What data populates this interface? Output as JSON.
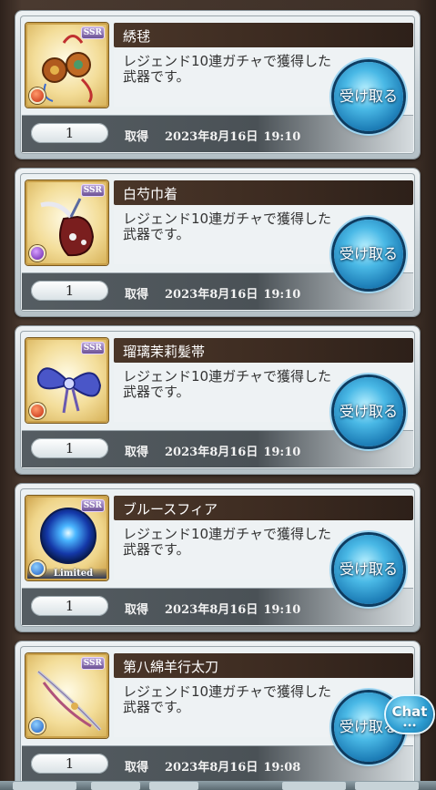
{
  "items": [
    {
      "name": "綉毬",
      "description": "レジェンド10連ガチャで獲得した武器です。",
      "rarity": "SSR",
      "element": "fire",
      "quantity": "1",
      "acquired_label": "取得",
      "acquired_date": "2023年8月16日",
      "acquired_time": "19:10",
      "claim_label": "受け取る",
      "limited_label": ""
    },
    {
      "name": "白芍巾着",
      "description": "レジェンド10連ガチャで獲得した武器です。",
      "rarity": "SSR",
      "element": "dark",
      "quantity": "1",
      "acquired_label": "取得",
      "acquired_date": "2023年8月16日",
      "acquired_time": "19:10",
      "claim_label": "受け取る",
      "limited_label": ""
    },
    {
      "name": "瑠璃茉莉髪帯",
      "description": "レジェンド10連ガチャで獲得した武器です。",
      "rarity": "SSR",
      "element": "fire",
      "quantity": "1",
      "acquired_label": "取得",
      "acquired_date": "2023年8月16日",
      "acquired_time": "19:10",
      "claim_label": "受け取る",
      "limited_label": ""
    },
    {
      "name": "ブルースフィア",
      "description": "レジェンド10連ガチャで獲得した武器です。",
      "rarity": "SSR",
      "element": "water",
      "quantity": "1",
      "acquired_label": "取得",
      "acquired_date": "2023年8月16日",
      "acquired_time": "19:10",
      "claim_label": "受け取る",
      "limited_label": "Limited"
    },
    {
      "name": "第八綿羊行太刀",
      "description": "レジェンド10連ガチャで獲得した武器です。",
      "rarity": "SSR",
      "element": "water",
      "quantity": "1",
      "acquired_label": "取得",
      "acquired_date": "2023年8月16日",
      "acquired_time": "19:08",
      "claim_label": "受け取る",
      "limited_label": ""
    }
  ],
  "chat": {
    "label": "Chat",
    "dots": "•••"
  },
  "colors": {
    "claim_button": "#2b9bd0",
    "title_bar": "#3b2a20",
    "background": "#3a2c24"
  }
}
